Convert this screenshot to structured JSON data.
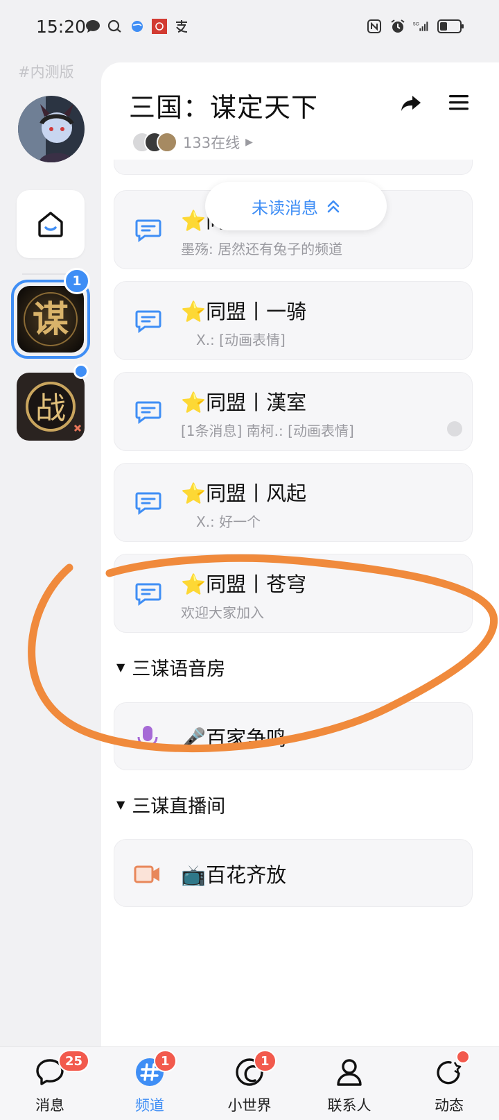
{
  "status_bar": {
    "time": "15:20",
    "left_icons": [
      "chat-bubble-icon",
      "loop-chat-icon",
      "vpn-globe-icon",
      "app-red-icon",
      "alipay-icon"
    ],
    "right_icons": [
      "nfc-icon",
      "alarm-icon",
      "signal-5g-icon",
      "battery-icon"
    ],
    "signal_label": "5G"
  },
  "rail": {
    "beta_label": "#内测版",
    "active_server_badge": "1"
  },
  "header": {
    "title": "三国：谋定天下",
    "online_text": "133在线"
  },
  "unread_pill": {
    "label": "未读消息"
  },
  "channels": [
    {
      "title": "同盟",
      "subtitle": "墨殇: 居然还有兔子的频道",
      "partially_hidden": true
    },
    {
      "title": "⭐同盟丨一骑",
      "subtitle": "X.: [动画表情]"
    },
    {
      "title": "⭐同盟丨漢室",
      "subtitle": "[1条消息] 南柯.: [动画表情]",
      "has_unread_dot": true
    },
    {
      "title": "⭐同盟丨风起",
      "subtitle": "X.: 好一个"
    },
    {
      "title": "⭐同盟丨苍穹",
      "subtitle": "欢迎大家加入"
    }
  ],
  "sections": {
    "voice": {
      "label": "三谋语音房",
      "rooms": [
        {
          "title": "🎤百家争鸣"
        }
      ]
    },
    "live": {
      "label": "三谋直播间",
      "rooms": [
        {
          "title": "📺百花齐放"
        }
      ]
    }
  },
  "bottom_nav": [
    {
      "label": "消息",
      "icon": "message-icon",
      "badge": "25",
      "active": false
    },
    {
      "label": "频道",
      "icon": "channel-hash-icon",
      "badge": "1",
      "active": true
    },
    {
      "label": "小世界",
      "icon": "small-world-icon",
      "badge": "1",
      "active": false
    },
    {
      "label": "联系人",
      "icon": "contacts-icon",
      "badge": "",
      "active": false
    },
    {
      "label": "动态",
      "icon": "moments-icon",
      "badge": "",
      "dot": true,
      "active": false
    }
  ],
  "colors": {
    "accent": "#3f8ef5",
    "badge_red": "#f25a4d",
    "annotation_orange": "#f08a3c",
    "voice_purple": "#a66ad6",
    "live_orange": "#e8875a"
  }
}
